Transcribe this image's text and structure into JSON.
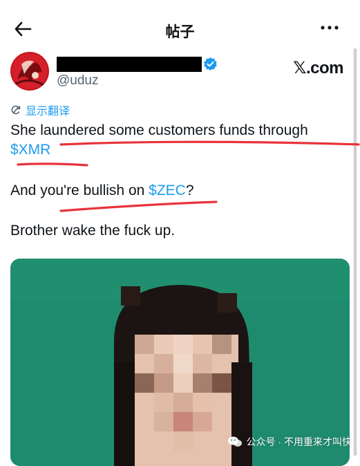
{
  "header": {
    "title": "帖子"
  },
  "tweet": {
    "handle": "@uduz",
    "brand": "𝕏.com",
    "translate_label": "显示翻译",
    "line1_text": "She laundered some customers funds through",
    "line1_tag": "$XMR",
    "line2_before": "And you're bullish on ",
    "line2_tag": "$ZEC",
    "line2_after": "?",
    "line3": "Brother wake the fuck up."
  },
  "watermark": {
    "text": "公众号 · 不用重来才叫快"
  },
  "colors": {
    "link": "#1d9bf0",
    "verified": "#1d9bf0",
    "annotation": "#e8333a",
    "media_bg": "#1e8b6e"
  },
  "icons": {
    "back": "arrow-left-icon",
    "more": "more-horizontal-icon",
    "verified": "verified-badge-icon",
    "translate": "translate-icon",
    "watermark": "wechat-icon"
  }
}
